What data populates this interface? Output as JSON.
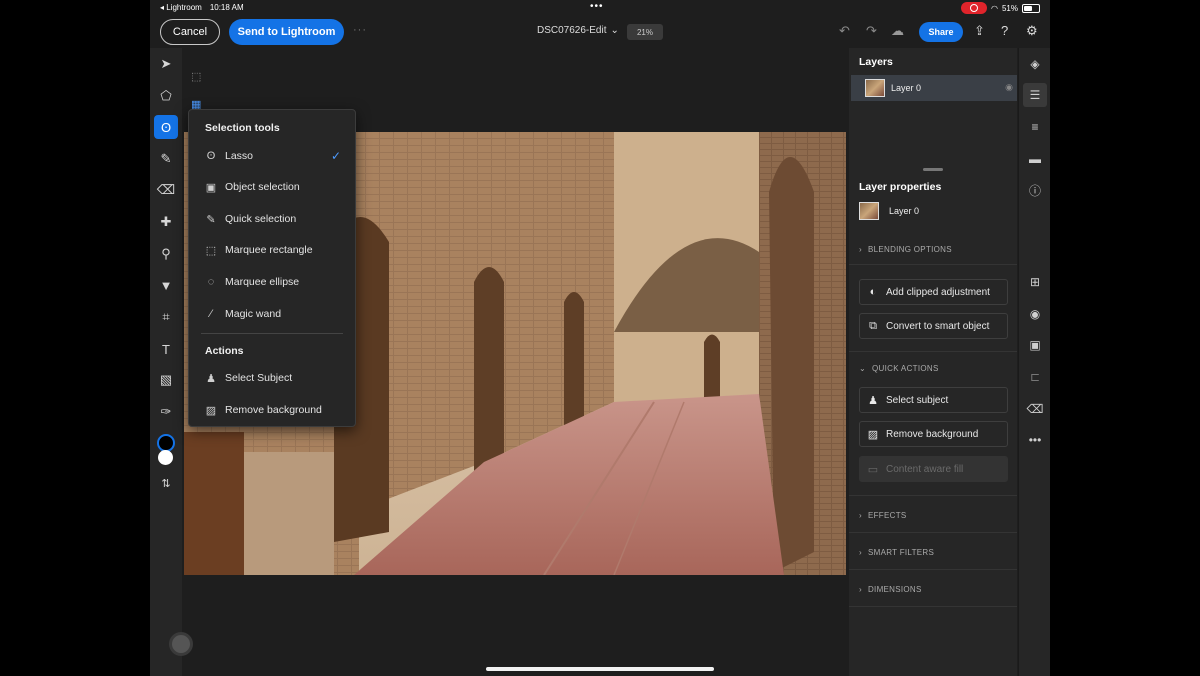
{
  "status_bar": {
    "back_app": "◂ Lightroom",
    "time": "10:18 AM",
    "battery": "51%"
  },
  "topbar": {
    "cancel_label": "Cancel",
    "send_label": "Send to Lightroom",
    "more_label": "···",
    "doc_title": "DSC07626-Edit",
    "doc_chevron": "⌄",
    "zoom": "21%",
    "share_label": "Share"
  },
  "selection_menu": {
    "header": "Selection tools",
    "items": [
      {
        "label": "Lasso",
        "icon": "lasso-icon",
        "glyph": "ʘ",
        "checked": true
      },
      {
        "label": "Object selection",
        "icon": "object-selection-icon",
        "glyph": "▣"
      },
      {
        "label": "Quick selection",
        "icon": "quick-selection-icon",
        "glyph": "✎"
      },
      {
        "label": "Marquee rectangle",
        "icon": "marquee-rectangle-icon",
        "glyph": "⬚"
      },
      {
        "label": "Marquee ellipse",
        "icon": "marquee-ellipse-icon",
        "glyph": "◌"
      },
      {
        "label": "Magic wand",
        "icon": "magic-wand-icon",
        "glyph": "⁄"
      }
    ],
    "check_glyph": "✓",
    "actions_header": "Actions",
    "actions": [
      {
        "label": "Select Subject",
        "icon": "select-subject-icon",
        "glyph": "♟"
      },
      {
        "label": "Remove background",
        "icon": "remove-background-icon",
        "glyph": "▨"
      }
    ]
  },
  "layers": {
    "title": "Layers",
    "layer_name": "Layer 0"
  },
  "layer_properties": {
    "title": "Layer properties",
    "layer_name": "Layer 0",
    "blending": "BLENDING OPTIONS",
    "add_clipped": "Add clipped adjustment",
    "convert_smart": "Convert to smart object",
    "quick_actions": "QUICK ACTIONS",
    "select_subject": "Select subject",
    "remove_background": "Remove background",
    "content_aware": "Content aware fill",
    "effects": "EFFECTS",
    "smart_filters": "SMART FILTERS",
    "dimensions": "DIMENSIONS"
  },
  "colors": {
    "accent": "#1473e6",
    "panel": "#262626",
    "canvas_bg": "#1e1e1e",
    "record": "#e0242b"
  }
}
